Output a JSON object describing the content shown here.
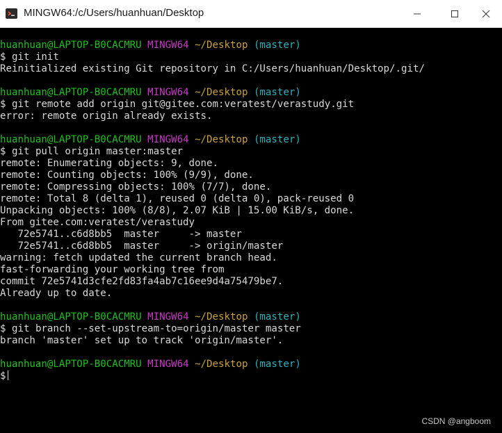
{
  "window": {
    "title": "MINGW64:/c/Users/huanhuan/Desktop",
    "minimize_glyph": "—",
    "maximize_glyph": "☐",
    "close_glyph": "✕"
  },
  "prompt": {
    "user": "huanhuan@LAPTOP-B0CACMRU",
    "system": "MINGW64",
    "path": "~/Desktop",
    "branch": "(master)",
    "symbol": "$"
  },
  "blocks": [
    {
      "command": "git init",
      "output": [
        "Reinitialized existing Git repository in C:/Users/huanhuan/Desktop/.git/"
      ]
    },
    {
      "command": "git remote add origin git@gitee.com:veratest/verastudy.git",
      "output": [
        "error: remote origin already exists."
      ]
    },
    {
      "command": "git pull origin master:master",
      "output": [
        "remote: Enumerating objects: 9, done.",
        "remote: Counting objects: 100% (9/9), done.",
        "remote: Compressing objects: 100% (7/7), done.",
        "remote: Total 8 (delta 1), reused 0 (delta 0), pack-reused 0",
        "Unpacking objects: 100% (8/8), 2.07 KiB | 15.00 KiB/s, done.",
        "From gitee.com:veratest/verastudy",
        "   72e5741..c6d8bb5  master     -> master",
        "   72e5741..c6d8bb5  master     -> origin/master",
        "warning: fetch updated the current branch head.",
        "fast-forwarding your working tree from",
        "commit 72e5741d3cfe2fd83fa4ab7c16ee9d4a75479be7.",
        "Already up to date."
      ]
    },
    {
      "command": "git branch --set-upstream-to=origin/master master",
      "output": [
        "branch 'master' set up to track 'origin/master'."
      ]
    }
  ],
  "watermark": "CSDN @angboom",
  "colors": {
    "background": "#000000",
    "text": "#d8d8d8",
    "user": "#1cc11c",
    "system": "#c839c5",
    "path": "#c8a03a",
    "branch": "#2fb0ba"
  }
}
